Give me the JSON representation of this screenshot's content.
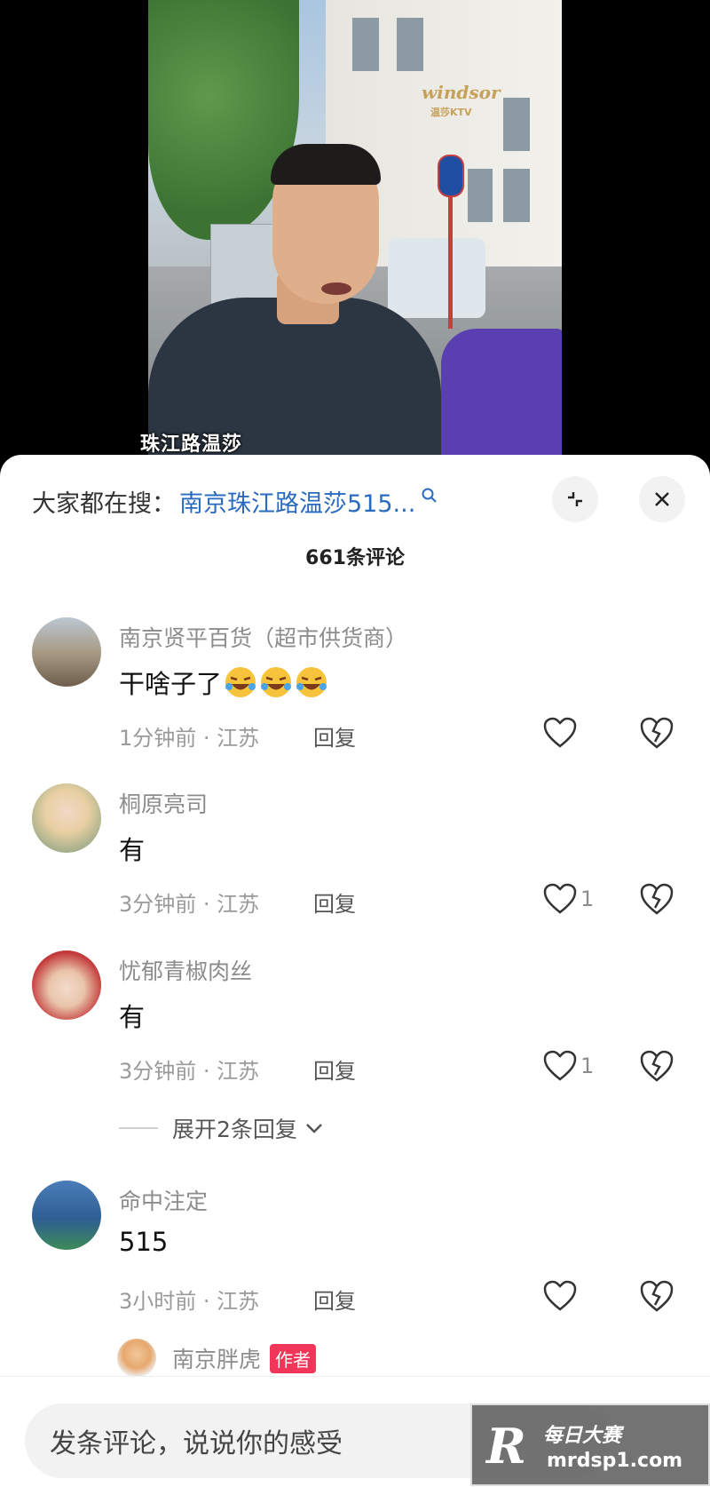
{
  "video": {
    "caption": "珠江路温莎",
    "shop_sign": "windsor",
    "shop_sign_sub": "温莎KTV"
  },
  "panel": {
    "search_prefix": "大家都在搜：",
    "search_term": "南京珠江路温莎515...",
    "comment_count": "661条评论"
  },
  "comments": [
    {
      "user": "南京贤平百货（超市供货商）",
      "text": "干啥子了",
      "emoji_count": 3,
      "time_location": "1分钟前 · 江苏",
      "reply": "回复",
      "likes": ""
    },
    {
      "user": "桐原亮司",
      "text": "有",
      "time_location": "3分钟前 · 江苏",
      "reply": "回复",
      "likes": "1"
    },
    {
      "user": "忧郁青椒肉丝",
      "text": "有",
      "time_location": "3分钟前 · 江苏",
      "reply": "回复",
      "likes": "1"
    },
    {
      "user": "命中注定",
      "text": "515",
      "time_location": "3小时前 · 江苏",
      "reply": "回复",
      "likes": ""
    }
  ],
  "expand_replies": "展开2条回复",
  "author_reply": {
    "user": "南京胖虎",
    "badge": "作者"
  },
  "input": {
    "placeholder": "发条评论，说说你的感受"
  },
  "watermark": {
    "logo": "R",
    "top": "每日大赛",
    "bottom": "mrdsp1.com"
  },
  "colors": {
    "link": "#2b6bbf",
    "badge": "#f2365a",
    "text": "#111111",
    "meta": "#9a9a9a"
  },
  "icons": [
    "search-icon",
    "collapse-icon",
    "close-icon",
    "heart-icon",
    "broken-heart-icon",
    "chevron-down-icon",
    "laughing-crying-emoji"
  ]
}
